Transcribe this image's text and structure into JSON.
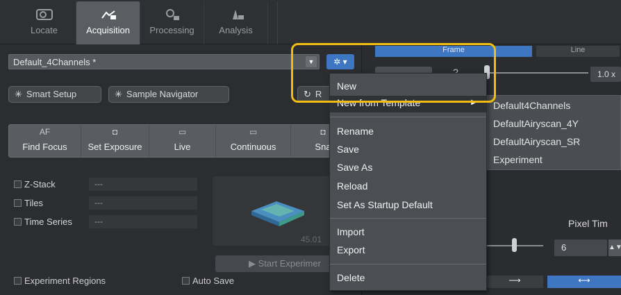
{
  "tabs": [
    {
      "label": "Locate",
      "icon": "locate-icon"
    },
    {
      "label": "Acquisition",
      "icon": "acquisition-icon"
    },
    {
      "label": "Processing",
      "icon": "processing-icon"
    },
    {
      "label": "Analysis",
      "icon": "analysis-icon"
    }
  ],
  "experiment": {
    "selected": "Default_4Channels *"
  },
  "buttons": {
    "smart_setup": "Smart Setup",
    "sample_navigator": "Sample Navigator",
    "r_partial": "R"
  },
  "toolbar": [
    {
      "icon_text": "AF",
      "label": "Find Focus"
    },
    {
      "icon_text": "◘",
      "label": "Set Exposure"
    },
    {
      "icon_text": "▭",
      "label": "Live"
    },
    {
      "icon_text": "▭",
      "label": "Continuous"
    },
    {
      "icon_text": "◘",
      "label": "Sna"
    }
  ],
  "options": [
    {
      "label": "Z-Stack",
      "value": "---"
    },
    {
      "label": "Tiles",
      "value": "---"
    },
    {
      "label": "Time Series",
      "value": "---"
    }
  ],
  "preview_value": "45.01",
  "start_label": "Start Experimer",
  "bottom": {
    "experiment_regions": "Experiment Regions",
    "auto_save": "Auto Save"
  },
  "right": {
    "frame_tab": "Frame",
    "line_tab": "Line",
    "zoom_value": "1.0 x",
    "zoom_label": "?",
    "pixel_label": "Pixel Tim",
    "pixel_value": "6"
  },
  "menu": {
    "items": [
      "New",
      "New from Template",
      "Rename",
      "Save",
      "Save As",
      "Reload",
      "Set As Startup Default",
      "Import",
      "Export",
      "Delete"
    ]
  },
  "submenu": {
    "items": [
      "Default4Channels",
      "DefaultAiryscan_4Y",
      "DefaultAiryscan_SR",
      "Experiment"
    ]
  },
  "colors": {
    "accent_blue": "#3f76c2",
    "highlight_ring": "#f2bd10"
  }
}
